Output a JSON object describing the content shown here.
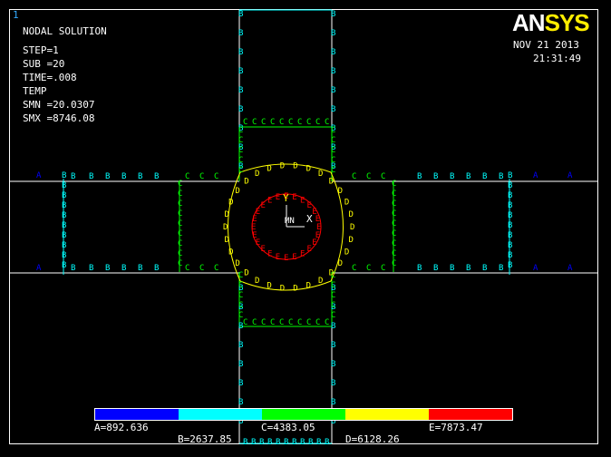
{
  "window": {
    "number": "1"
  },
  "logo": {
    "an": "AN",
    "sys": "SYS"
  },
  "info": {
    "title": "NODAL SOLUTION",
    "step": "STEP=1",
    "sub": "SUB =20",
    "time": "TIME=.008",
    "item": "TEMP",
    "smn": "SMN =20.0307",
    "smx": "SMX =8746.08"
  },
  "datetime": {
    "date": "NOV 21 2013",
    "time": "21:31:49"
  },
  "markers": {
    "min": "MN",
    "max": "MX",
    "axis_x": "X",
    "axis_y": "Y"
  },
  "legend": {
    "bands": [
      {
        "letter": "A",
        "color": "#0000ff",
        "value": "892.636",
        "label": "A=892.636"
      },
      {
        "letter": "B",
        "color": "#00ffff",
        "value": "2637.85",
        "label": "B=2637.85"
      },
      {
        "letter": "C",
        "color": "#00ff00",
        "value": "4383.05",
        "label": "C=4383.05"
      },
      {
        "letter": "D",
        "color": "#ffff00",
        "value": "6128.26",
        "label": "D=6128.26"
      },
      {
        "letter": "E",
        "color": "#ff0000",
        "value": "7873.47",
        "label": "E=7873.47"
      }
    ]
  }
}
